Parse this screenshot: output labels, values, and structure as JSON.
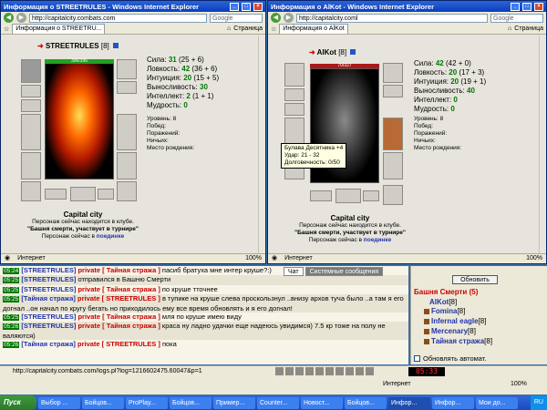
{
  "left_window": {
    "title": "Информация о STREETRULES - Windows Internet Explorer",
    "url": "http://capitalcity.combats.com",
    "search": "Google",
    "tab": "Информация о STREETRU...",
    "page_menu": "Страница",
    "character": {
      "name": "STREETRULES",
      "level": "[8]",
      "hp": "396/396",
      "stats": [
        {
          "label": "Сила:",
          "value": "31",
          "extra": "(25 + 6)"
        },
        {
          "label": "Ловкость:",
          "value": "42",
          "extra": "(36 + 6)"
        },
        {
          "label": "Интуиция:",
          "value": "20",
          "extra": "(15 + 5)"
        },
        {
          "label": "Выносливость:",
          "value": "30",
          "extra": ""
        },
        {
          "label": "Интеллект:",
          "value": "2",
          "extra": "(1 + 1)"
        },
        {
          "label": "Мудрость:",
          "value": "0",
          "extra": ""
        }
      ],
      "info": [
        "Уровень: 8",
        "Побед:",
        "Поражений:",
        "Ничьих:",
        "Место рождения:"
      ],
      "city": "Capital city",
      "location_line1": "Персонаж сейчас находится в клубе.",
      "location_line2": "\"Башня смерти, участвует в турнире\"",
      "location_line3": "Персонаж сейчас в",
      "location_link": "поединке"
    },
    "status": "Интернет",
    "zoom": "100%"
  },
  "right_window": {
    "title": "Информация о AlKot - Windows Internet Explorer",
    "url": "http://capitalcity.coml",
    "search": "Google",
    "tab": "Информация о AlKot",
    "page_menu": "Страница",
    "character": {
      "name": "AlKot",
      "level": "[8]",
      "hp": "70/327",
      "stats": [
        {
          "label": "Сила:",
          "value": "42",
          "extra": "(42 + 0)"
        },
        {
          "label": "Ловкость:",
          "value": "20",
          "extra": "(17 + 3)"
        },
        {
          "label": "Интуиция:",
          "value": "20",
          "extra": "(19 + 1)"
        },
        {
          "label": "Выносливость:",
          "value": "40",
          "extra": ""
        },
        {
          "label": "Интеллект:",
          "value": "0",
          "extra": ""
        },
        {
          "label": "Мудрость:",
          "value": "0",
          "extra": ""
        }
      ],
      "info": [
        "Уровень: 8",
        "Побед:",
        "Поражений:",
        "Ничьих:",
        "Место рождения:"
      ],
      "city": "Capital city",
      "location_line1": "Персонаж сейчас находится в клубе.",
      "location_line2": "\"Башня смерти, участвует в турнире\"",
      "location_line3": "Персонаж сейчас в",
      "location_link": "поединке"
    },
    "tooltip": [
      "Булава Десятника +4",
      "Удар: 21 - 32",
      "Долговечность: 0/50"
    ],
    "status": "Интернет",
    "zoom": "100%"
  },
  "chat": {
    "tabs": [
      "Чат",
      "Системные сообщения"
    ],
    "lines": [
      {
        "time": "05:24",
        "who": "[STREETRULES]",
        "priv": "private [ Тайная стража ]",
        "text": "пасиб братуха мне интер крушe?:)"
      },
      {
        "time": "05:25",
        "who": "[STREETRULES]",
        "priv": "",
        "text": "отправился в Башню Смерти"
      },
      {
        "time": "05:25",
        "who": "[STREETRULES]",
        "priv": "private [ Тайная стража ]",
        "text": "по круше тточнее"
      },
      {
        "time": "05:25",
        "who": "[Тайная стража]",
        "priv": "private [ STREETRULES ]",
        "text": "в тупике на круше слева проскользнул ..внизу архов туча было ..а там я его догнал ..он начал по кругу бегать но приходилось ему все время обновлять и я его догнал!"
      },
      {
        "time": "05:25",
        "who": "[STREETRULES]",
        "priv": "private [ Тайная стража ]",
        "text": "мля по круше имею виду"
      },
      {
        "time": "05:26",
        "who": "[STREETRULES]",
        "priv": "private [ Тайная стража ]",
        "text": "краса ну ладно удачки еще надеюсь увидимся) 7.5 кр тоже на полу не валяются)"
      },
      {
        "time": "05:26",
        "who": "[Тайная стража]",
        "priv": "private [ STREETRULES ]",
        "text": "пока"
      }
    ]
  },
  "players": {
    "refresh": "Обновить",
    "title": "Башня Смерти (5)",
    "items": [
      {
        "name": "AlKot",
        "level": "[8]"
      },
      {
        "name": "Fomina",
        "level": "[8]"
      },
      {
        "name": "Infernal eagle",
        "level": "[8]"
      },
      {
        "name": "Mercenary",
        "level": "[8]"
      },
      {
        "name": "Тайная стража",
        "level": "[8]"
      }
    ],
    "auto": "Обновлять автомат."
  },
  "ie_status": {
    "url": "http://capitalcity.combats.com/logs.pl?log=1216602475.60047&p=1",
    "status": "Интернет",
    "zoom": "100%",
    "clock": "05:33"
  },
  "taskbar": {
    "start": "Пуск",
    "tasks": [
      "Выбор ...",
      "Бойцов...",
      "ProPlay...",
      "Бойцов...",
      "Пример...",
      "Counter...",
      "Новост...",
      "Бойцов...",
      "Инфор...",
      "Инфор...",
      "Мои до..."
    ],
    "tray": "RU"
  },
  "colors": {
    "accent": "#0a3dbd",
    "stat_green": "#007700",
    "link_blue": "#2233aa",
    "private_red": "#cc0000"
  }
}
